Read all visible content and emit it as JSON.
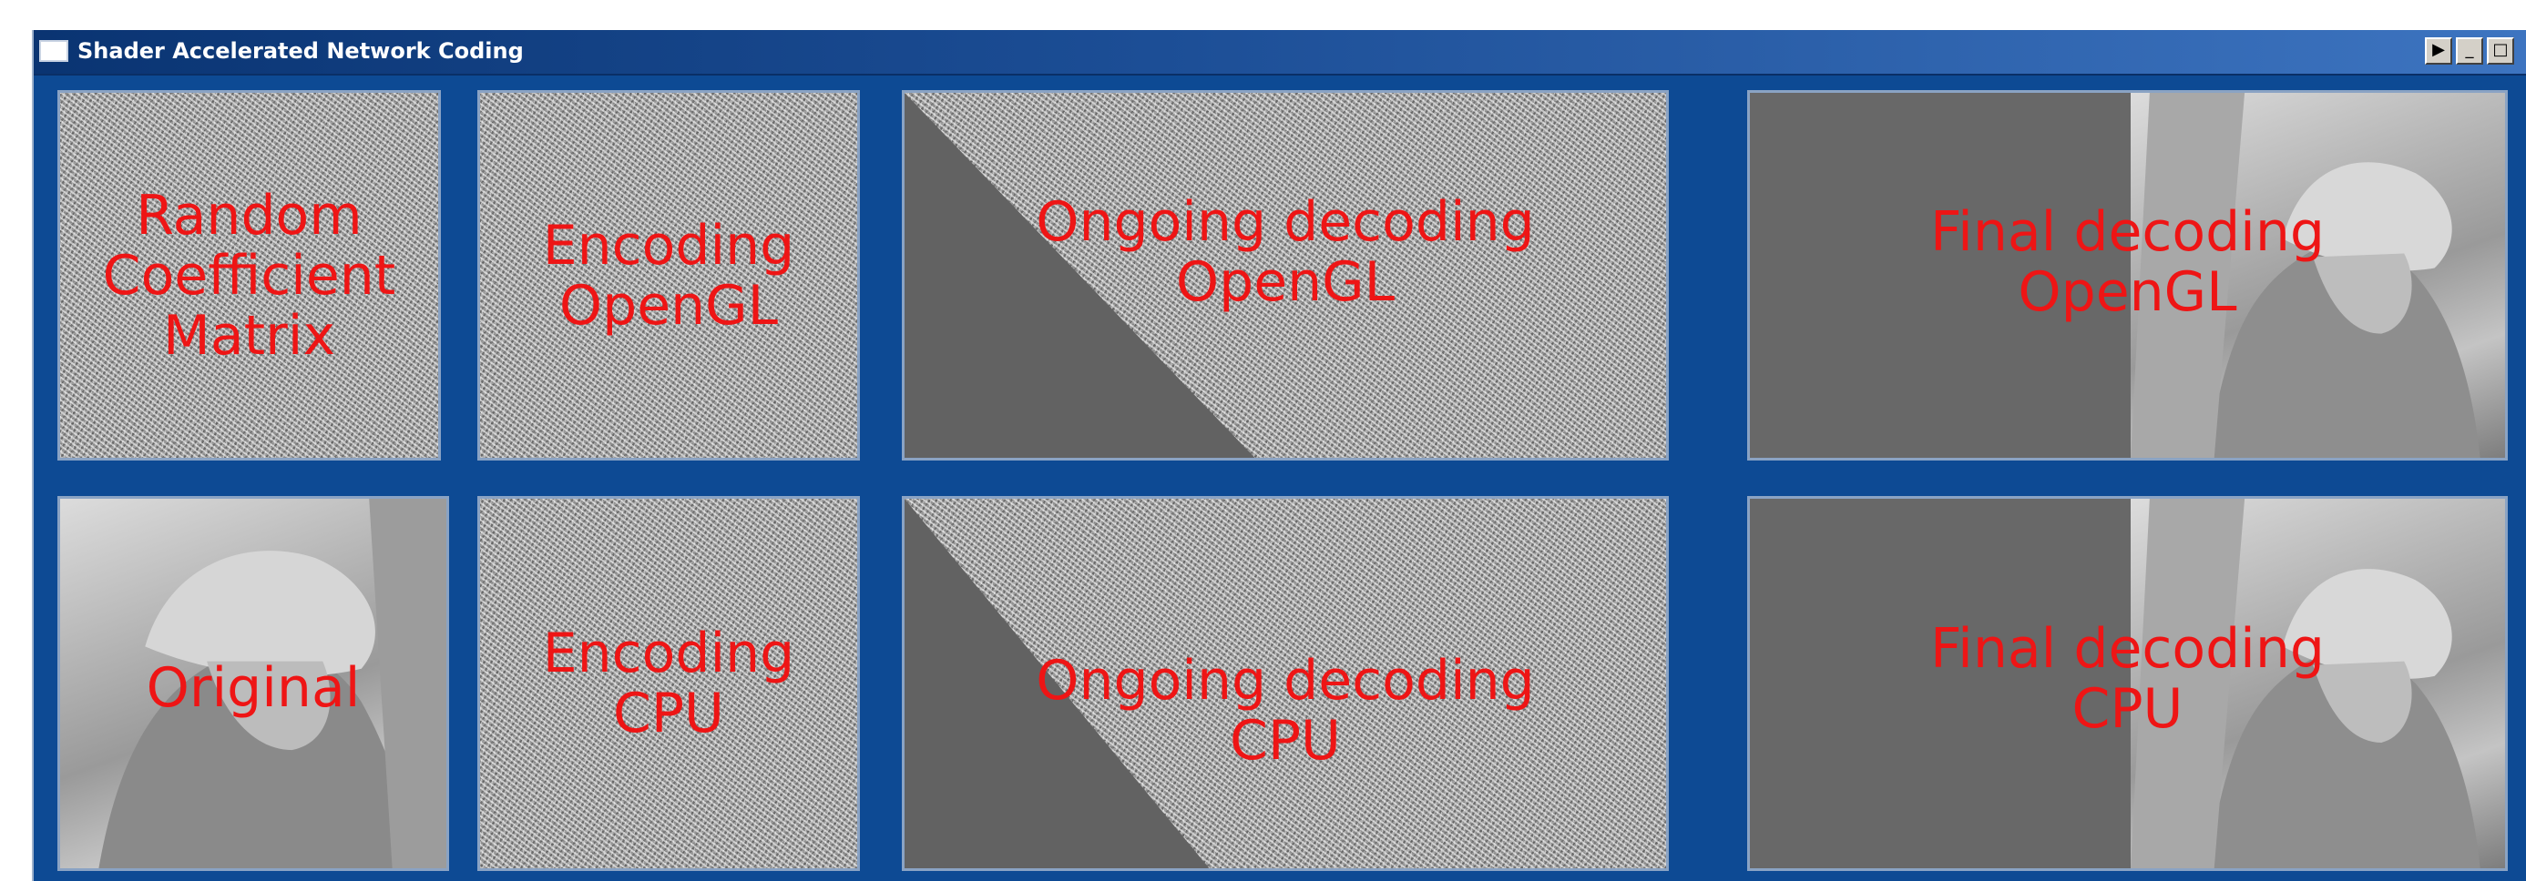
{
  "window": {
    "title": "Shader Accelerated Network Coding",
    "buttons": [
      "▶",
      "_",
      "□"
    ]
  },
  "panels": {
    "random_matrix": [
      "Random",
      "Coefficient",
      "Matrix"
    ],
    "encoding_opengl": [
      "Encoding",
      "OpenGL"
    ],
    "ongoing_opengl": [
      "Ongoing decoding",
      "OpenGL"
    ],
    "final_opengl": [
      "Final decoding",
      "OpenGL"
    ],
    "original": [
      "Original"
    ],
    "encoding_cpu": [
      "Encoding",
      "CPU"
    ],
    "ongoing_cpu": [
      "Ongoing decoding",
      "CPU"
    ],
    "final_cpu": [
      "Final decoding",
      "CPU"
    ]
  },
  "colors": {
    "window_bg": "#0d4a94",
    "label_red": "#ee1515",
    "decoded_gray": "#626262"
  }
}
